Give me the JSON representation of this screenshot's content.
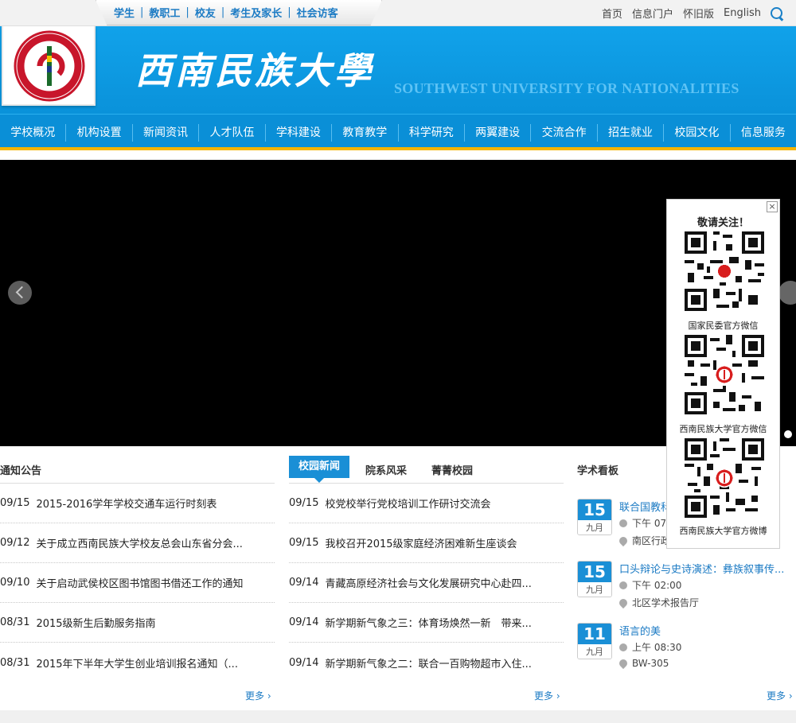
{
  "top_tabs": [
    "学生",
    "教职工",
    "校友",
    "考生及家长",
    "社会访客"
  ],
  "top_links": [
    "首页",
    "信息门户",
    "怀旧版",
    "English"
  ],
  "header": {
    "cn_title": "西南民族大學",
    "en_title": "SOUTHWEST UNIVERSITY FOR NATIONALITIES"
  },
  "nav": [
    "学校概况",
    "机构设置",
    "新闻资讯",
    "人才队伍",
    "学科建设",
    "教育教学",
    "科学研究",
    "两翼建设",
    "交流合作",
    "招生就业",
    "校园文化",
    "信息服务"
  ],
  "follow": {
    "title": "敬请关注！",
    "close": "×",
    "qrs": [
      "国家民委官方微信",
      "西南民族大学官方微信",
      "西南民族大学官方微博"
    ]
  },
  "notices": {
    "title": "通知公告",
    "items": [
      {
        "date": "09/15",
        "text": "2015-2016学年学校交通车运行时刻表"
      },
      {
        "date": "09/12",
        "text": "关于成立西南民族大学校友总会山东省分会..."
      },
      {
        "date": "09/10",
        "text": "关于启动武侯校区图书馆图书借还工作的通知"
      },
      {
        "date": "08/31",
        "text": "2015级新生后勤服务指南"
      },
      {
        "date": "08/31",
        "text": "2015年下半年大学生创业培训报名通知（..."
      }
    ],
    "more": "更多"
  },
  "news": {
    "tabs": [
      "校园新闻",
      "院系风采",
      "菁菁校园"
    ],
    "items": [
      {
        "date": "09/15",
        "text": "校党校举行党校培训工作研讨交流会"
      },
      {
        "date": "09/15",
        "text": "我校召开2015级家庭经济困难新生座谈会"
      },
      {
        "date": "09/14",
        "text": "青藏高原经济社会与文化发展研究中心赴四..."
      },
      {
        "date": "09/14",
        "text": "新学期新气象之三：体育场焕然一新　带来..."
      },
      {
        "date": "09/14",
        "text": "新学期新气象之二：联合一百购物超市入住..."
      }
    ],
    "more": "更多"
  },
  "academic": {
    "title": "学术看板",
    "events": [
      {
        "day": "15",
        "month": "九月",
        "title": "联合国教科文组织...",
        "time": "下午 07:...",
        "place": "南区行政..."
      },
      {
        "day": "15",
        "month": "九月",
        "title": "口头辩论与史诗演述：彝族叙事传...",
        "time": "下午 02:00",
        "place": "北区学术报告厅"
      },
      {
        "day": "11",
        "month": "九月",
        "title": "语言的美",
        "time": "上午 08:30",
        "place": "BW-305"
      }
    ],
    "more": "更多"
  },
  "colors": {
    "brand_blue": "#0e9be2",
    "accent_yellow": "#f4b400",
    "link_blue": "#1c7bc4"
  }
}
